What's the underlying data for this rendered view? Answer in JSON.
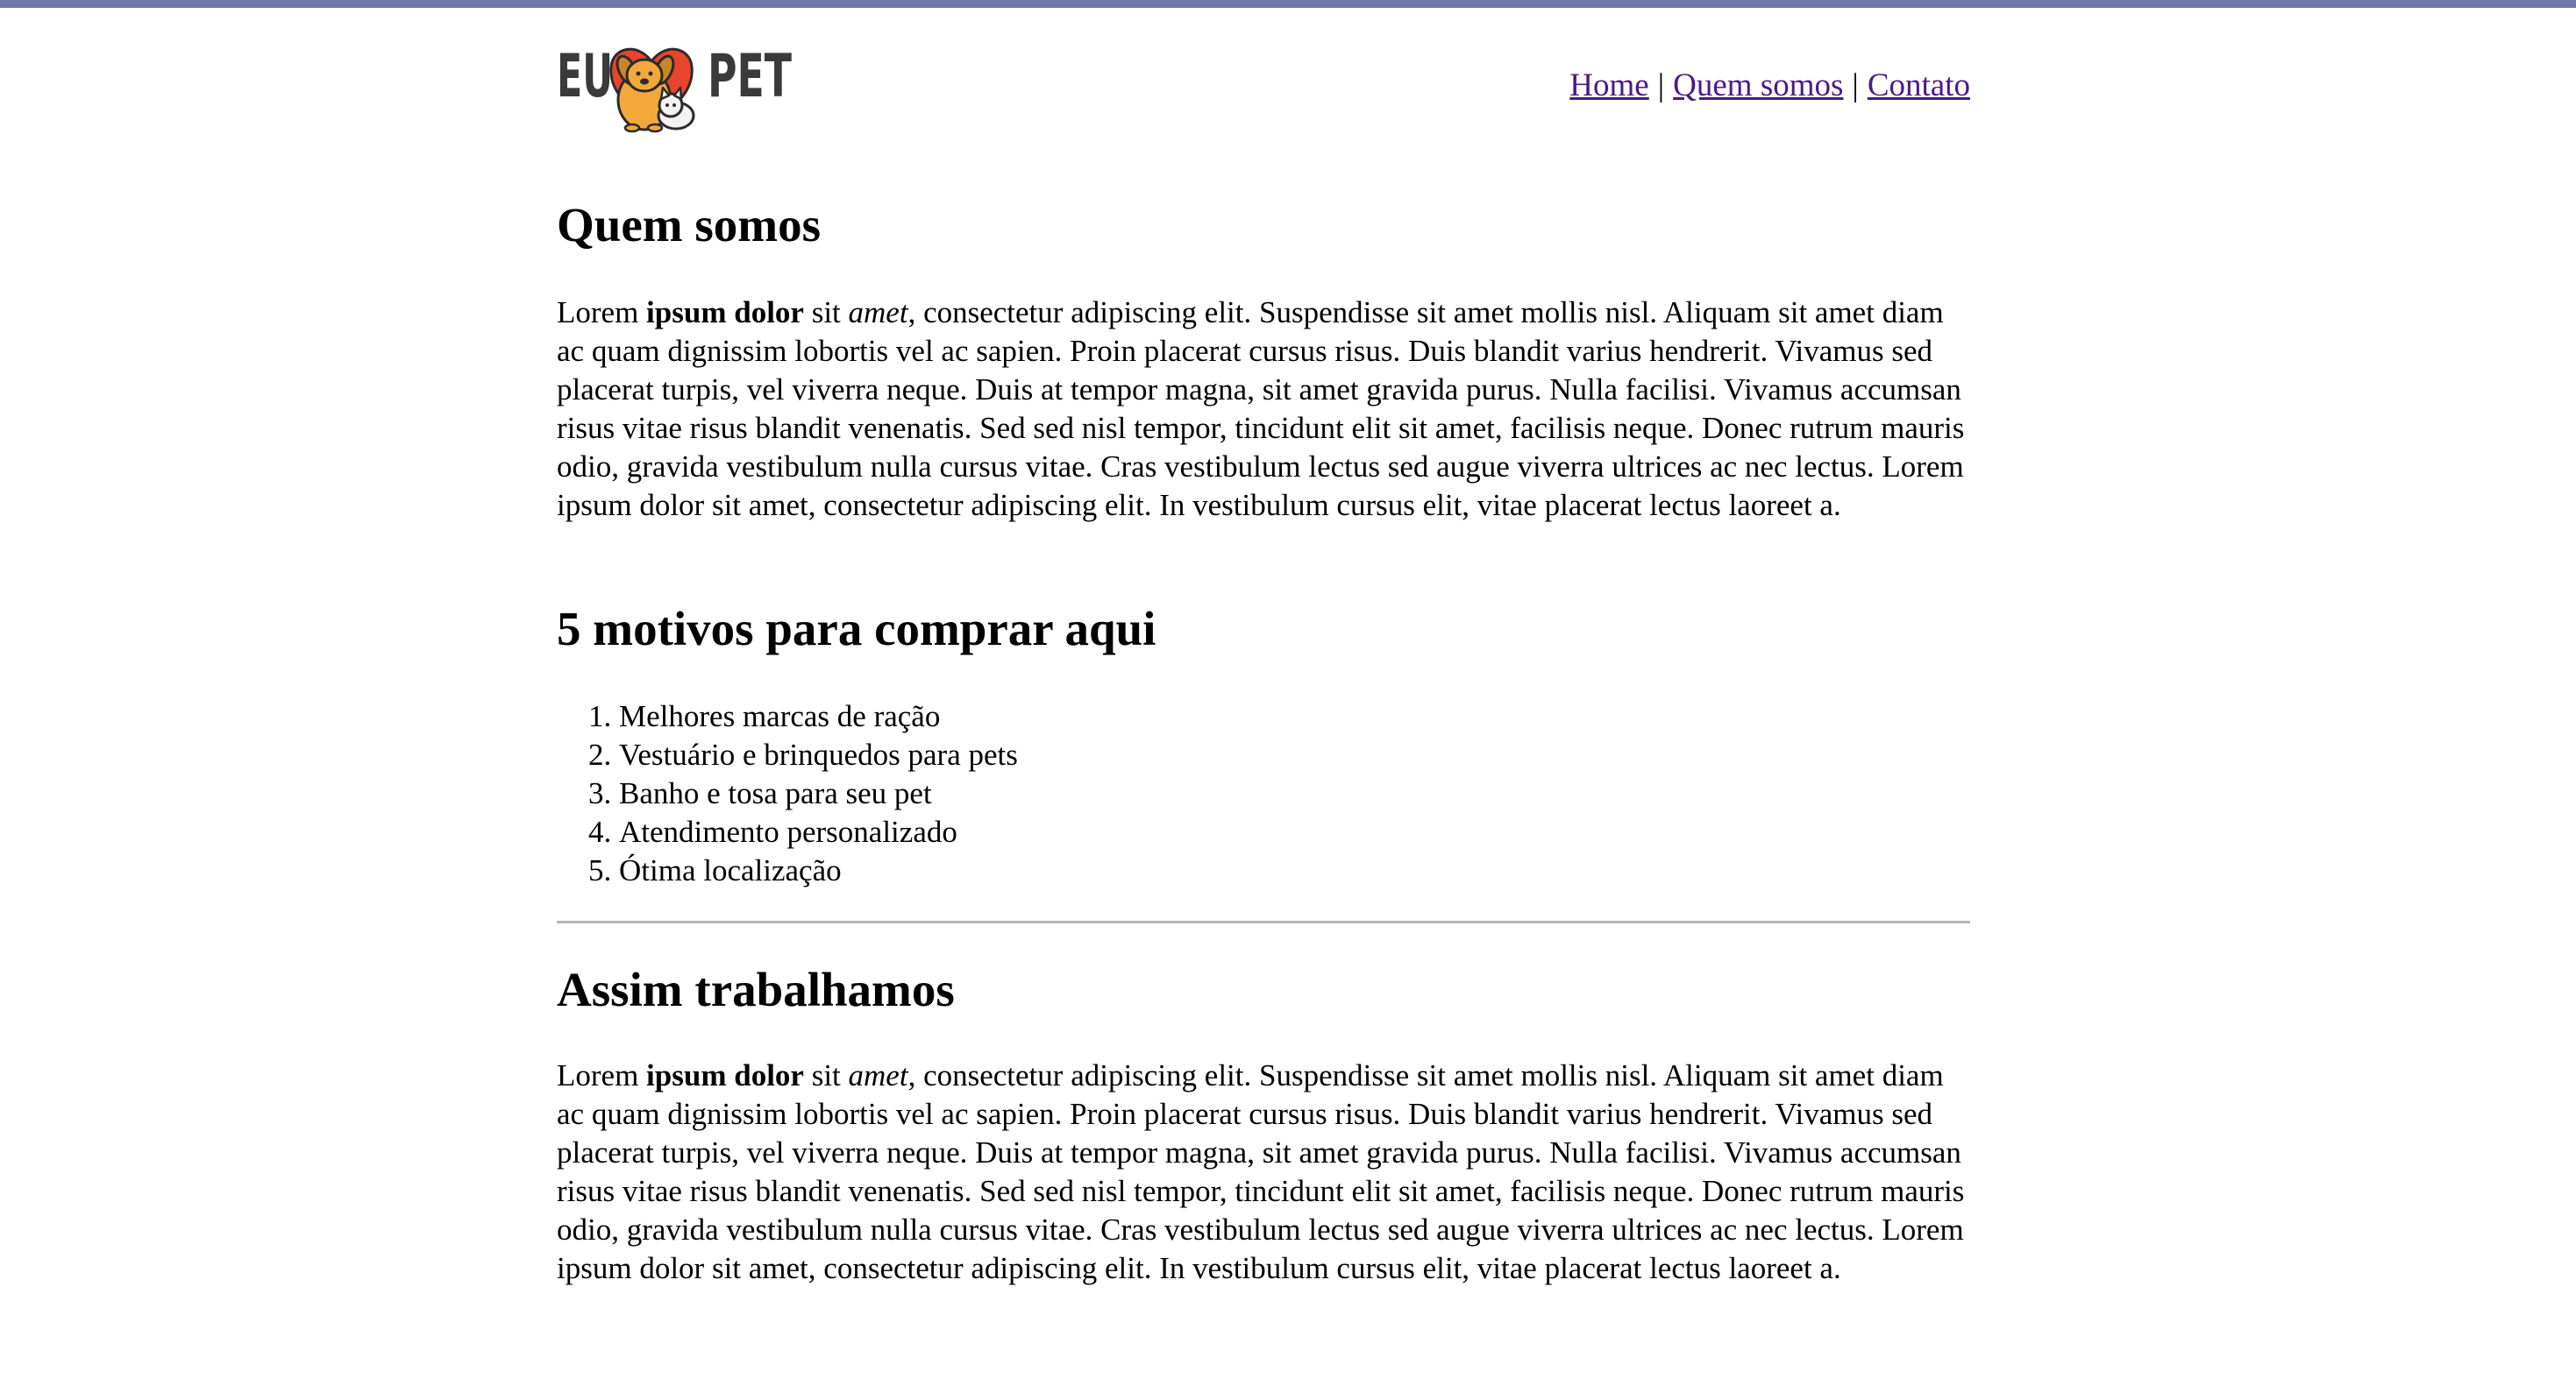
{
  "header": {
    "logo": {
      "text_left": "EU",
      "text_right": "PET",
      "icon": "heart-dog-cat-icon",
      "colors": {
        "text": "#3a3a3a",
        "heart": "#e8452c",
        "dog": "#f3a93a",
        "cat": "#f2f2f2"
      }
    },
    "nav": {
      "items": [
        {
          "label": "Home"
        },
        {
          "label": "Quem somos"
        },
        {
          "label": "Contato"
        }
      ],
      "separator": "|",
      "link_color": "#4b1a88"
    }
  },
  "about": {
    "heading": "Quem somos",
    "paragraph": {
      "lead": "Lorem ",
      "bold": "ipsum dolor",
      "mid": " sit ",
      "italic": "amet",
      "rest": ", consectetur adipiscing elit. Suspendisse sit amet mollis nisl. Aliquam sit amet diam ac quam dignissim lobortis vel ac sapien. Proin placerat cursus risus. Duis blandit varius hendrerit. Vivamus sed placerat turpis, vel viverra neque. Duis at tempor magna, sit amet gravida purus. Nulla facilisi. Vivamus accumsan risus vitae risus blandit venenatis. Sed sed nisl tempor, tincidunt elit sit amet, facilisis neque. Donec rutrum mauris odio, gravida vestibulum nulla cursus vitae. Cras vestibulum lectus sed augue viverra ultrices ac nec lectus. Lorem ipsum dolor sit amet, consectetur adipiscing elit. In vestibulum cursus elit, vitae placerat lectus laoreet a."
    }
  },
  "reasons": {
    "heading": "5 motivos para comprar aqui",
    "items": [
      "Melhores marcas de ração",
      "Vestuário e brinquedos para pets",
      "Banho e tosa para seu pet",
      "Atendimento personalizado",
      "Ótima localização"
    ]
  },
  "work": {
    "heading": "Assim trabalhamos",
    "paragraph": {
      "lead": "Lorem ",
      "bold": "ipsum dolor",
      "mid": " sit ",
      "italic": "amet",
      "rest": ", consectetur adipiscing elit. Suspendisse sit amet mollis nisl. Aliquam sit amet diam ac quam dignissim lobortis vel ac sapien. Proin placerat cursus risus. Duis blandit varius hendrerit. Vivamus sed placerat turpis, vel viverra neque. Duis at tempor magna, sit amet gravida purus. Nulla facilisi. Vivamus accumsan risus vitae risus blandit venenatis. Sed sed nisl tempor, tincidunt elit sit amet, facilisis neque. Donec rutrum mauris odio, gravida vestibulum nulla cursus vitae. Cras vestibulum lectus sed augue viverra ultrices ac nec lectus. Lorem ipsum dolor sit amet, consectetur adipiscing elit. In vestibulum cursus elit, vitae placerat lectus laoreet a."
    }
  },
  "theme": {
    "top_border": "#7078a8",
    "divider": "#b5b5b5"
  }
}
